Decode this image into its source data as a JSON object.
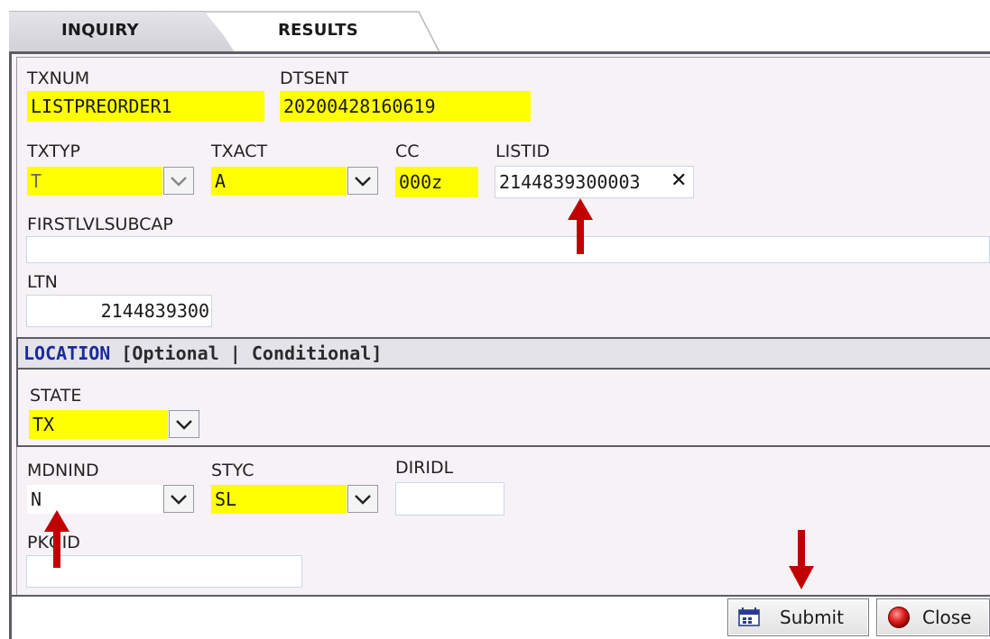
{
  "tabs": {
    "inquiry": "INQUIRY",
    "results": "RESULTS"
  },
  "form": {
    "txnum": {
      "label": "TXNUM",
      "value": "LISTPREORDER1"
    },
    "dtsent": {
      "label": "DTSENT",
      "value": "20200428160619"
    },
    "txtyp": {
      "label": "TXTYP",
      "value": "T"
    },
    "txact": {
      "label": "TXACT",
      "value": "A"
    },
    "cc": {
      "label": "CC",
      "value": "000z"
    },
    "listid": {
      "label": "LISTID",
      "value": "2144839300003",
      "clear_glyph": "✕"
    },
    "firstlvlsubcap": {
      "label": "FIRSTLVLSUBCAP",
      "value": ""
    },
    "ltn": {
      "label": "LTN",
      "value": "2144839300"
    }
  },
  "location_section": {
    "title": "LOCATION",
    "suffix": " [Optional | Conditional]",
    "state": {
      "label": "STATE",
      "value": "TX"
    }
  },
  "form2": {
    "mdnind": {
      "label": "MDNIND",
      "value": "N"
    },
    "styc": {
      "label": "STYC",
      "value": "SL"
    },
    "diridl": {
      "label": "DIRIDL",
      "value": ""
    },
    "pkgid": {
      "label": "PKGID",
      "value": ""
    }
  },
  "footer": {
    "submit_label": "Submit",
    "close_label": "Close"
  },
  "colors": {
    "required_field": "#ffff00",
    "panel_bg": "#f6f2f6",
    "section_title": "#1a2a9a",
    "arrow": "#c00000"
  },
  "icons": {
    "dropdown": "chevron-down-icon",
    "clear": "clear-x-icon",
    "submit": "submit-icon",
    "close": "close-circle-icon",
    "annotation": "red-arrow-icon"
  }
}
